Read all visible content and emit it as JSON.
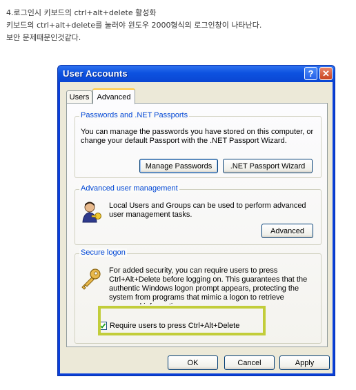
{
  "blog": {
    "line1": "4.로그인시 키보드의 ctrl+alt+delete 활성화",
    "line2": "키보드의 ctrl+alt+delete를 눌러야 윈도우 2000형식의 로그인창이 나타난다.",
    "line3": "보안 문제때문인것같다."
  },
  "window": {
    "title": "User Accounts",
    "help_label": "?",
    "close_label": "✕"
  },
  "tabs": [
    {
      "label": "Users",
      "selected": false
    },
    {
      "label": "Advanced",
      "selected": true
    }
  ],
  "passwords_group": {
    "label": "Passwords and .NET Passports",
    "text": "You can manage the passwords you have stored on this computer, or change your default Passport with the .NET Passport Wizard.",
    "manage_button": "Manage Passwords",
    "wizard_button": ".NET Passport Wizard"
  },
  "advanced_group": {
    "label": "Advanced user management",
    "text": "Local Users and Groups can be used to perform advanced user management tasks.",
    "advanced_button": "Advanced",
    "icon": "users-key-icon"
  },
  "secure_group": {
    "label": "Secure logon",
    "text": "For added security, you can require users to press Ctrl+Alt+Delete before logging on. This guarantees that the authentic Windows logon prompt appears, protecting the system from programs that mimic a logon to retrieve password information.",
    "checkbox_label": "Require users to press Ctrl+Alt+Delete",
    "checkbox_checked": true,
    "icon": "key-icon"
  },
  "dialog_buttons": {
    "ok": "OK",
    "cancel": "Cancel",
    "apply": "Apply"
  },
  "colors": {
    "title_bar": "#0a46d3",
    "group_label": "#0046d5",
    "highlight": "#c2cd3a"
  }
}
